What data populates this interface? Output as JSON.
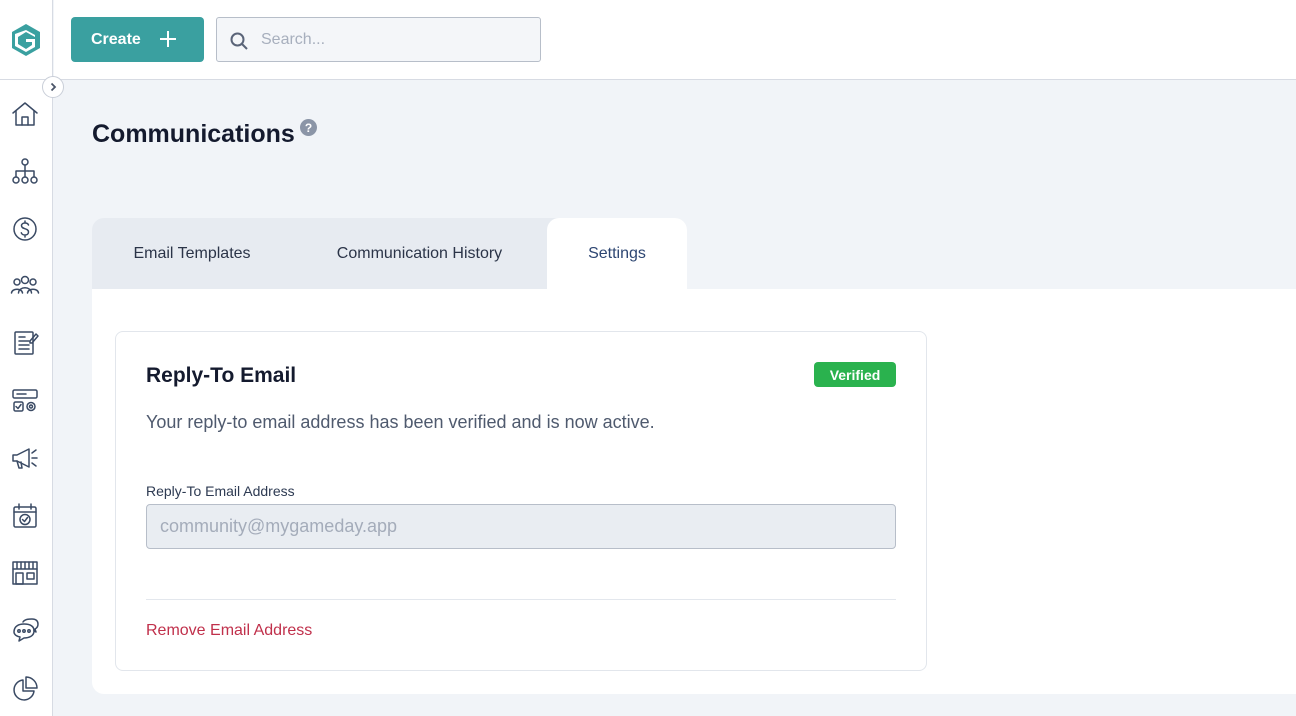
{
  "app": {
    "brand_color": "#3aa0a0",
    "logo_icon": "g-logo-icon"
  },
  "sidebar": {
    "items": [
      {
        "name": "home",
        "icon": "home-icon"
      },
      {
        "name": "organization",
        "icon": "org-chart-icon"
      },
      {
        "name": "finance",
        "icon": "dollar-icon"
      },
      {
        "name": "members",
        "icon": "people-icon"
      },
      {
        "name": "registrations",
        "icon": "form-icon"
      },
      {
        "name": "programs",
        "icon": "settings-panel-icon"
      },
      {
        "name": "marketing",
        "icon": "megaphone-icon"
      },
      {
        "name": "events",
        "icon": "calendar-check-icon"
      },
      {
        "name": "store",
        "icon": "store-icon"
      },
      {
        "name": "communications",
        "icon": "chat-icon"
      },
      {
        "name": "reports",
        "icon": "pie-chart-icon"
      }
    ]
  },
  "topbar": {
    "create_label": "Create",
    "search_placeholder": "Search..."
  },
  "page": {
    "title": "Communications",
    "help_glyph": "?"
  },
  "tabs": [
    {
      "label": "Email Templates",
      "active": false
    },
    {
      "label": "Communication History",
      "active": false
    },
    {
      "label": "Settings",
      "active": true
    }
  ],
  "card": {
    "title": "Reply-To Email",
    "badge": "Verified",
    "badge_color": "#2ab24e",
    "description": "Your reply-to email address has been verified and is now active.",
    "field_label": "Reply-To Email Address",
    "field_value": "community@mygameday.app",
    "remove_label": "Remove Email Address",
    "remove_color": "#c0304b"
  }
}
